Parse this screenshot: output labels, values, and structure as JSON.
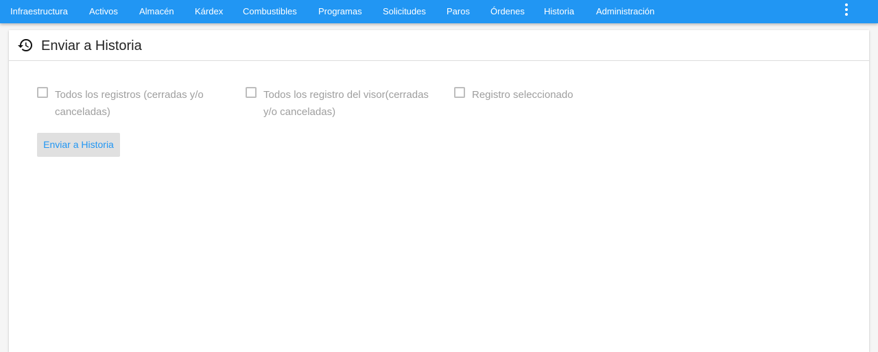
{
  "nav": {
    "items": [
      {
        "label": "Infraestructura"
      },
      {
        "label": "Activos"
      },
      {
        "label": "Almacén"
      },
      {
        "label": "Kárdex"
      },
      {
        "label": "Combustibles"
      },
      {
        "label": "Programas"
      },
      {
        "label": "Solicitudes"
      },
      {
        "label": "Paros"
      },
      {
        "label": "Órdenes"
      },
      {
        "label": "Historia"
      },
      {
        "label": "Administración"
      }
    ],
    "menu_icon": "more-vert-icon"
  },
  "colors": {
    "primary": "#2196f3",
    "disabled_text": "#9e9e9e",
    "button_bg": "#e0e0e0"
  },
  "panel": {
    "title": "Enviar a Historia",
    "icon": "history-icon",
    "options": [
      {
        "label_line1": "Todos los registros (cerradas y/o",
        "label_line2": "canceladas)",
        "checked": false
      },
      {
        "label_line1": "Todos los registro del visor(cerradas",
        "label_line2": "y/o canceladas)",
        "checked": false
      },
      {
        "label_line1": "Registro seleccionado",
        "checked": false
      }
    ],
    "submit_label": "Enviar a Historia"
  }
}
